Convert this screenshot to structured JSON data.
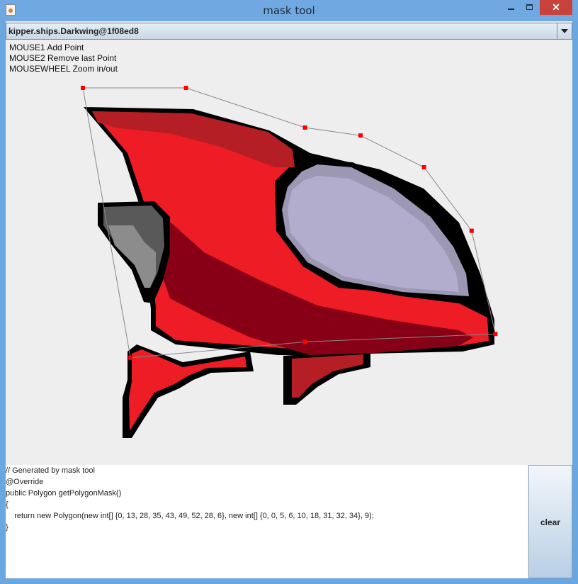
{
  "window": {
    "title": "mask tool",
    "close_label": "✕"
  },
  "ship_selector": {
    "value": "kipper.ships.Darkwing@1f08ed8"
  },
  "help": [
    "MOUSE1 Add Point",
    "MOUSE2 Remove last Point",
    "MOUSEWHEEL Zoom in/out"
  ],
  "code": {
    "lines": [
      "// Generated by mask tool",
      "@Override",
      "public Polygon getPolygonMask()",
      "{",
      "    return new Polygon(new int[] {0, 13, 28, 35, 43, 49, 52, 28, 6}, new int[] {0, 0, 5, 6, 10, 18, 31, 32, 34}, 9);",
      "}"
    ]
  },
  "clear_button": {
    "label": "clear"
  },
  "colors": {
    "outline": "#000000",
    "hull_red": "#ee1c24",
    "hull_dark_red": "#b41e24",
    "hull_shadow": "#880015",
    "cockpit": "#b3adcd",
    "cockpit_shade": "#9c97b3",
    "engine_dark": "#595959",
    "engine_light": "#8c8c8c",
    "mask_point": "#ff0000",
    "mask_line": "#888888"
  },
  "mask": {
    "xs": [
      0,
      13,
      28,
      35,
      43,
      49,
      52,
      28,
      6
    ],
    "ys": [
      0,
      0,
      5,
      6,
      10,
      18,
      31,
      32,
      34
    ]
  }
}
